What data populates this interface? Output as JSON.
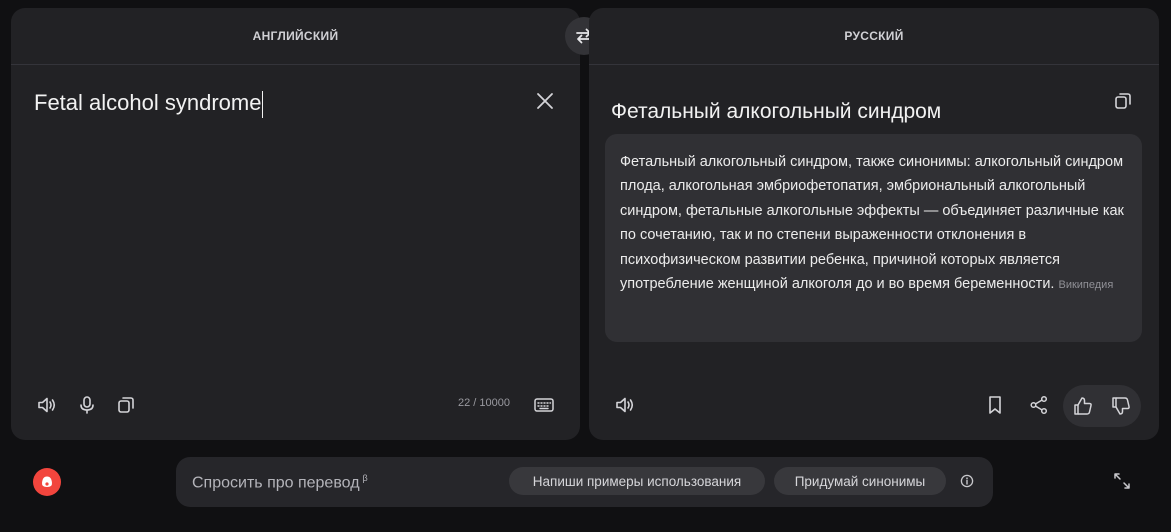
{
  "source_panel": {
    "language": "АНГЛИЙСКИЙ",
    "text": "Fetal alcohol syndrome",
    "char_counter": "22 / 10000"
  },
  "target_panel": {
    "language": "РУССКИЙ",
    "translation": "Фетальный алкогольный синдром",
    "wiki": {
      "text": "Фетальный алкогольный синдром, также синонимы: алкогольный синдром плода, алкогольная эмбриофетопатия, эмбриональный алкогольный синдром, фетальные алкогольные эффекты — объединяет различные как по сочетанию, так и по степени выраженности отклонения в психофизическом развитии ребенка, причиной которых является употребление женщиной алкоголя до и во время беременности.",
      "source": "Википедия"
    }
  },
  "assistant_bar": {
    "placeholder": "Спросить про перевод",
    "beta_mark": "β",
    "chips": [
      "Напиши примеры использования",
      "Придумай синонимы"
    ]
  },
  "icons": {
    "swap": "swap-arrows-icon",
    "clear": "close-icon",
    "speaker": "speaker-icon",
    "mic": "microphone-icon",
    "copy": "copy-icon",
    "keyboard": "keyboard-icon",
    "bookmark": "bookmark-icon",
    "share": "share-icon",
    "like": "thumbs-up-icon",
    "dislike": "thumbs-down-icon",
    "info": "info-icon",
    "expand": "expand-icon",
    "alice": "alice-logo-icon"
  },
  "colors": {
    "panel_bg": "#222225",
    "page_bg": "#101012",
    "card_bg": "#303034",
    "alice_accent": "#f2453d"
  }
}
